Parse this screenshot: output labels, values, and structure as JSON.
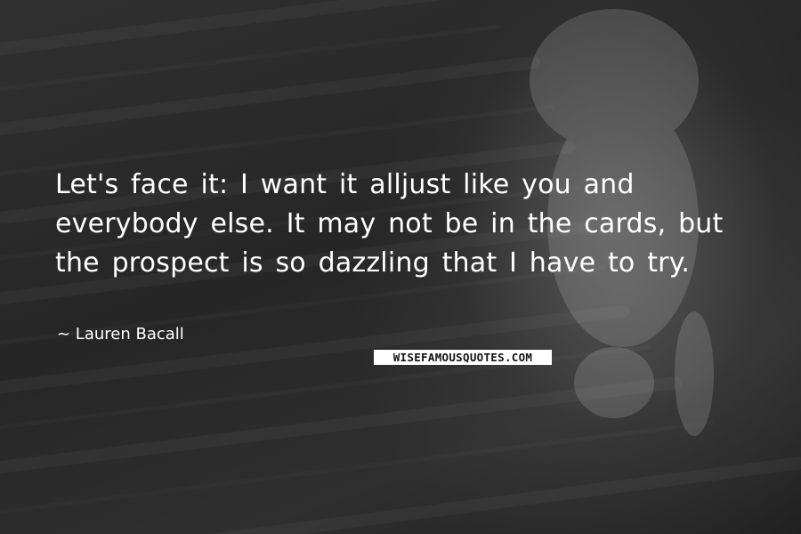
{
  "quote": {
    "text": "Let's face it: I want it alljust like you and everybody else. It may not be in the cards, but the prospect is so dazzling that I have to try.",
    "author": "~ Lauren Bacall"
  },
  "watermark": {
    "text": "WISEFAMOUSQUOTES.COM"
  },
  "colors": {
    "background": "#2b2b2b",
    "text": "#ffffff",
    "watermark_bg": "#ffffff",
    "watermark_text": "#111111"
  }
}
